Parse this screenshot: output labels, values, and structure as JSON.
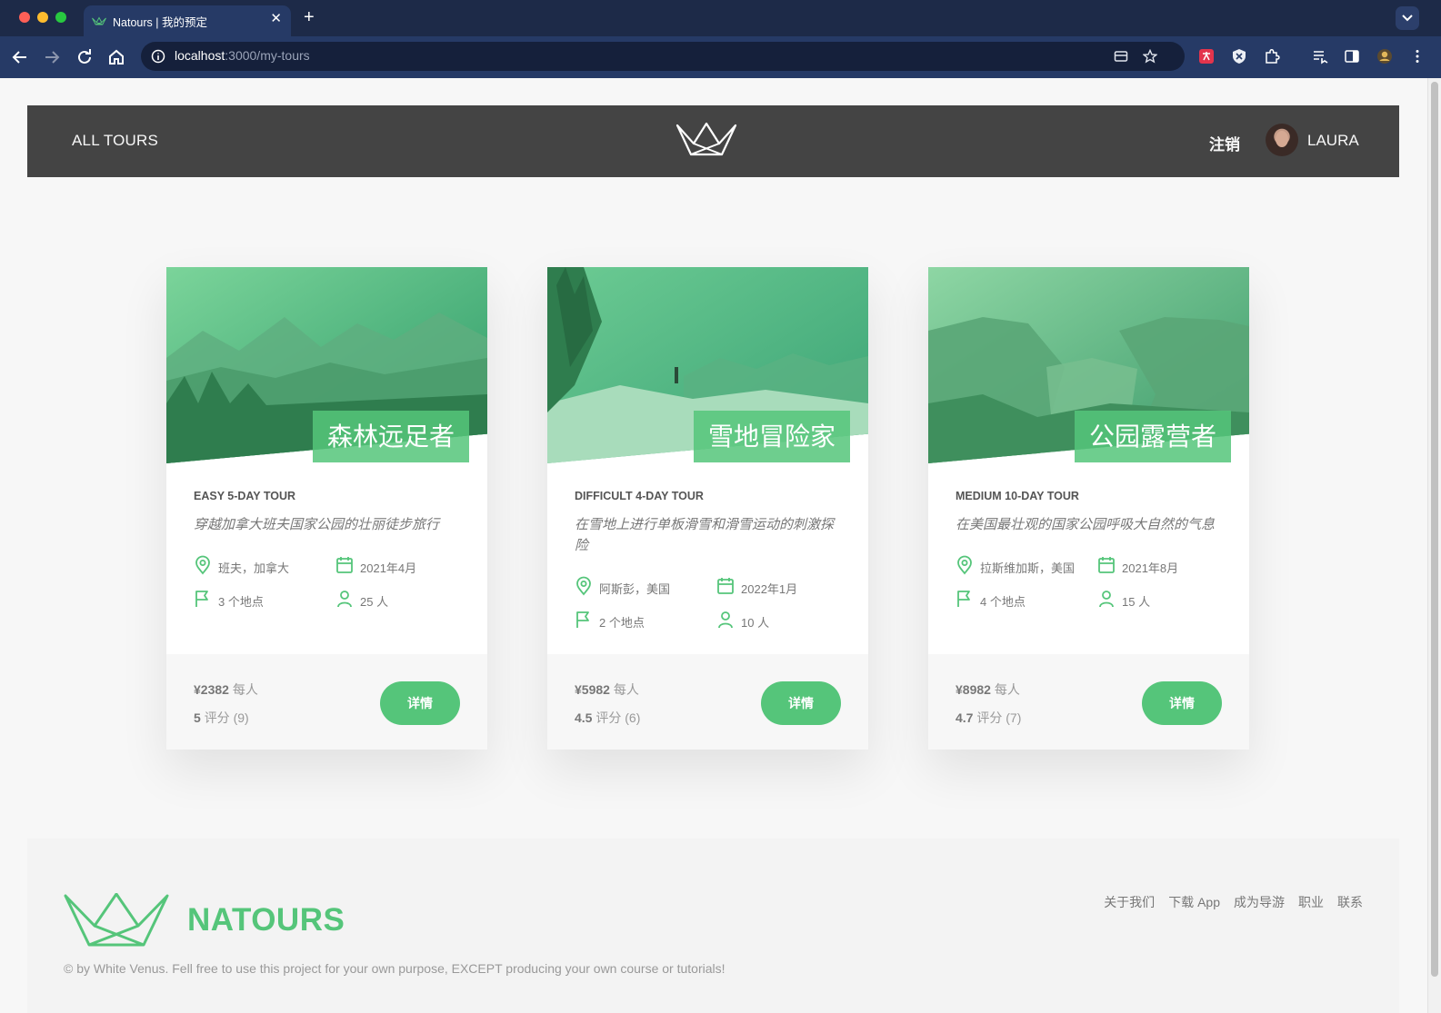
{
  "browser": {
    "tab_title": "Natours | 我的预定",
    "url_host": "localhost",
    "url_path": ":3000/my-tours"
  },
  "header": {
    "all_tours": "ALL TOURS",
    "logout": "注销",
    "user_name": "LAURA"
  },
  "tours": [
    {
      "title": "森林远足者",
      "subheading": "EASY 5-DAY TOUR",
      "summary": "穿越加拿大班夫国家公园的壮丽徒步旅行",
      "location": "班夫，加拿大",
      "date": "2021年4月",
      "stops": "3 个地点",
      "people": "25 人",
      "price": "¥2382",
      "price_unit": "每人",
      "rating": "5",
      "rating_label": "评分 (9)",
      "button": "详情"
    },
    {
      "title": "雪地冒险家",
      "subheading": "DIFFICULT 4-DAY TOUR",
      "summary": "在雪地上进行单板滑雪和滑雪运动的刺激探险",
      "location": "阿斯彭，美国",
      "date": "2022年1月",
      "stops": "2 个地点",
      "people": "10 人",
      "price": "¥5982",
      "price_unit": "每人",
      "rating": "4.5",
      "rating_label": "评分 (6)",
      "button": "详情"
    },
    {
      "title": "公园露营者",
      "subheading": "MEDIUM 10-DAY TOUR",
      "summary": "在美国最壮观的国家公园呼吸大自然的气息",
      "location": "拉斯维加斯，美国",
      "date": "2021年8月",
      "stops": "4 个地点",
      "people": "15 人",
      "price": "¥8982",
      "price_unit": "每人",
      "rating": "4.7",
      "rating_label": "评分 (7)",
      "button": "详情"
    }
  ],
  "footer": {
    "brand": "NATOURS",
    "nav": [
      "关于我们",
      "下载 App",
      "成为导游",
      "职业",
      "联系"
    ],
    "copyright": "© by White Venus. Fell free to use this project for your own purpose, EXCEPT producing your own course or tutorials!"
  },
  "colors": {
    "brand_green": "#55c57a",
    "header_bg": "#444444",
    "chrome_bg": "#263a66"
  }
}
